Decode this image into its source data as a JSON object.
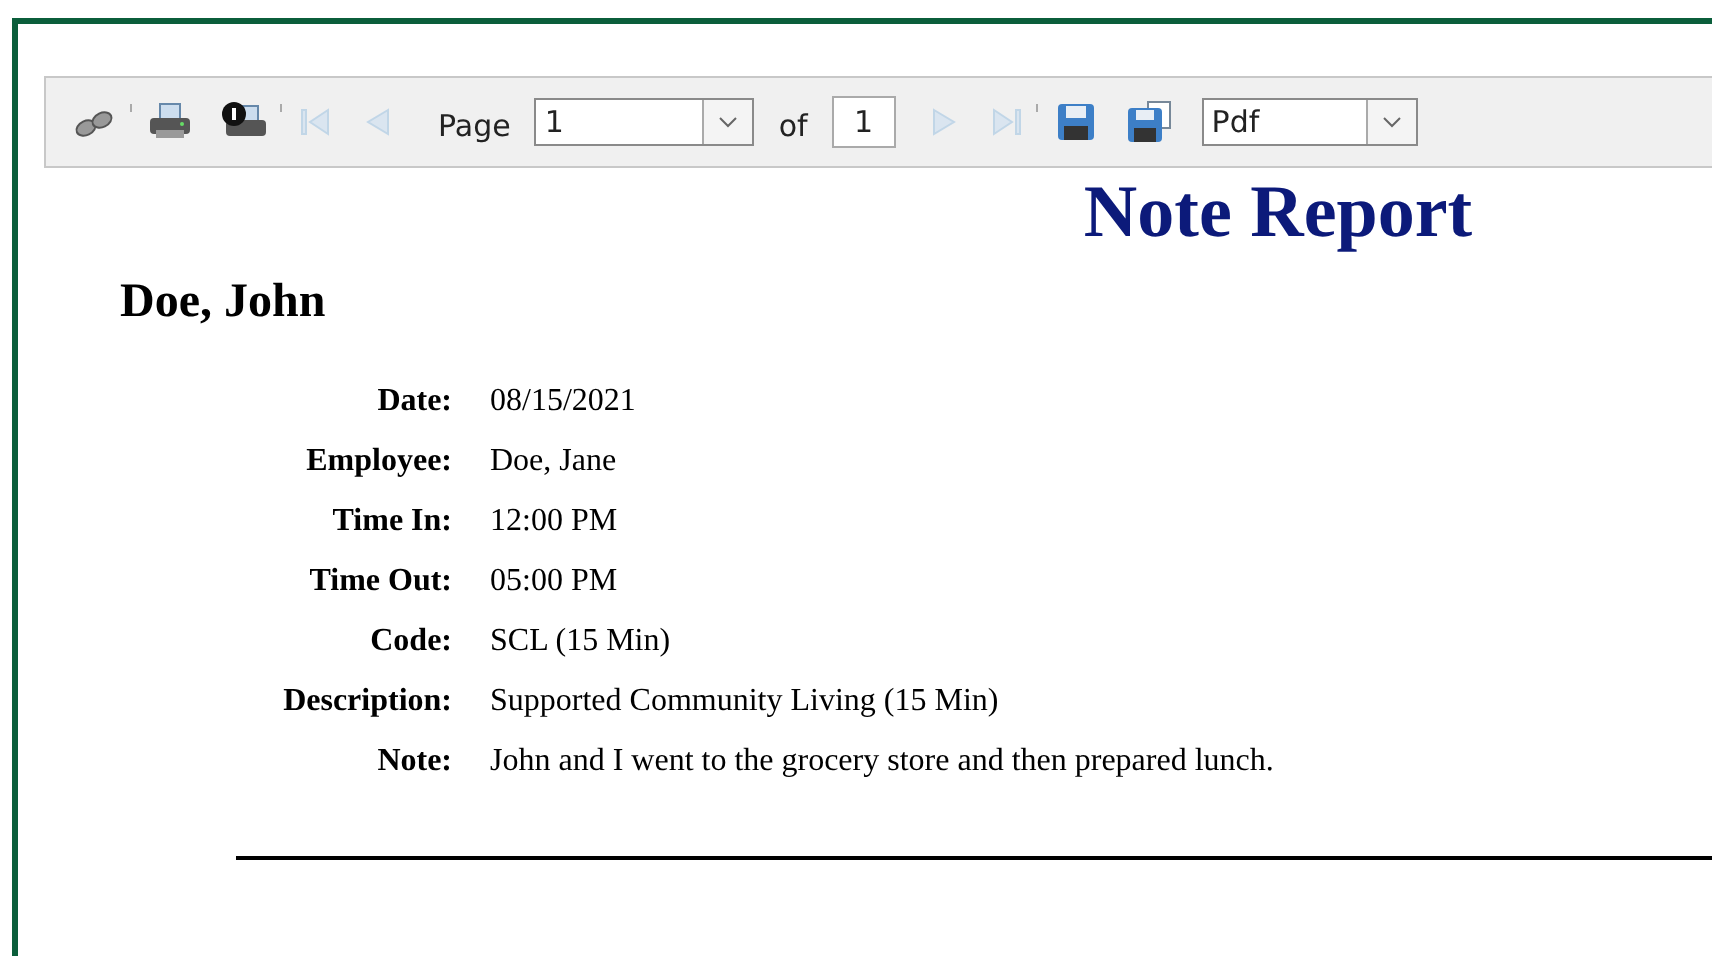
{
  "toolbar": {
    "buttons": [
      {
        "kind": "search",
        "disabled": false
      },
      {
        "kind": "print",
        "disabled": false
      },
      {
        "kind": "print-info",
        "disabled": false
      },
      {
        "kind": "first",
        "disabled": true
      },
      {
        "kind": "prev",
        "disabled": true
      }
    ],
    "page_label": "Page",
    "page_value": "1",
    "of_label": "of",
    "page_count": "1",
    "nav_buttons": [
      {
        "kind": "next",
        "disabled": true
      },
      {
        "kind": "last",
        "disabled": true
      }
    ],
    "save_buttons": [
      {
        "kind": "save"
      },
      {
        "kind": "save-copy"
      }
    ],
    "format_value": "Pdf"
  },
  "report": {
    "title": "Note Report",
    "client": "Doe, John",
    "fields": [
      {
        "label": "Date:",
        "value": "08/15/2021"
      },
      {
        "label": "Employee:",
        "value": "Doe, Jane"
      },
      {
        "label": "Time In:",
        "value": "12:00 PM"
      },
      {
        "label": "Time Out:",
        "value": "05:00 PM"
      },
      {
        "label": "Code:",
        "value": "SCL (15 Min)"
      },
      {
        "label": "Description:",
        "value": "Supported Community Living (15 Min)"
      },
      {
        "label": "Note:",
        "value": "John and I went to the grocery store and then prepared lunch."
      }
    ]
  }
}
